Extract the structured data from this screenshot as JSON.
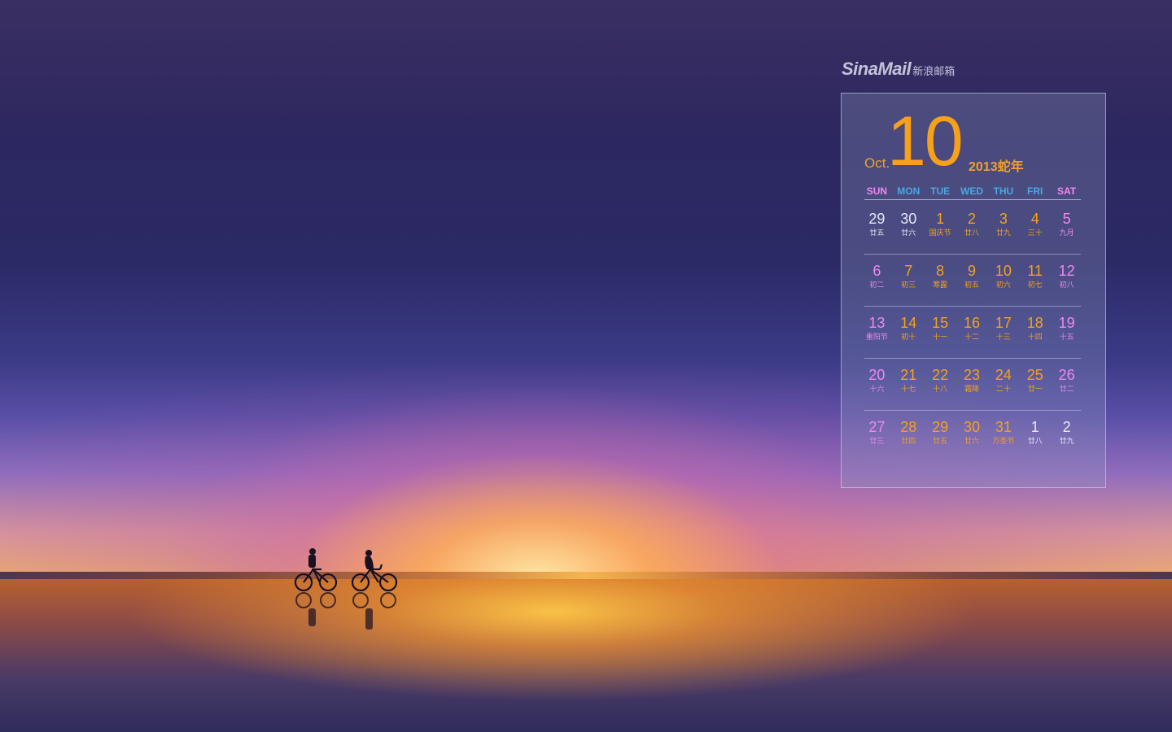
{
  "logo": {
    "brand": "SinaMail",
    "sub": "新浪邮箱"
  },
  "calendar": {
    "month_en": "Oct.",
    "month_num": "10",
    "year_label": "2013蛇年",
    "weekdays": [
      {
        "label": "SUN",
        "color": "#ef88ef"
      },
      {
        "label": "MON",
        "color": "#4aa8e0"
      },
      {
        "label": "TUE",
        "color": "#4aa8e0"
      },
      {
        "label": "WED",
        "color": "#4aa8e0"
      },
      {
        "label": "THU",
        "color": "#4aa8e0"
      },
      {
        "label": "FRI",
        "color": "#4aa8e0"
      },
      {
        "label": "SAT",
        "color": "#ef88ef"
      }
    ],
    "weeks": [
      [
        {
          "n": "29",
          "l": "廿五",
          "c": "white"
        },
        {
          "n": "30",
          "l": "廿六",
          "c": "white"
        },
        {
          "n": "1",
          "l": "国庆节",
          "c": "orange"
        },
        {
          "n": "2",
          "l": "廿八",
          "c": "orange"
        },
        {
          "n": "3",
          "l": "廿九",
          "c": "orange"
        },
        {
          "n": "4",
          "l": "三十",
          "c": "orange"
        },
        {
          "n": "5",
          "l": "九月",
          "c": "pink"
        }
      ],
      [
        {
          "n": "6",
          "l": "初二",
          "c": "pink"
        },
        {
          "n": "7",
          "l": "初三",
          "c": "orange"
        },
        {
          "n": "8",
          "l": "寒露",
          "c": "orange"
        },
        {
          "n": "9",
          "l": "初五",
          "c": "orange"
        },
        {
          "n": "10",
          "l": "初六",
          "c": "orange"
        },
        {
          "n": "11",
          "l": "初七",
          "c": "orange"
        },
        {
          "n": "12",
          "l": "初八",
          "c": "pink"
        }
      ],
      [
        {
          "n": "13",
          "l": "重阳节",
          "c": "pink"
        },
        {
          "n": "14",
          "l": "初十",
          "c": "orange"
        },
        {
          "n": "15",
          "l": "十一",
          "c": "orange"
        },
        {
          "n": "16",
          "l": "十二",
          "c": "orange"
        },
        {
          "n": "17",
          "l": "十三",
          "c": "orange"
        },
        {
          "n": "18",
          "l": "十四",
          "c": "orange"
        },
        {
          "n": "19",
          "l": "十五",
          "c": "pink"
        }
      ],
      [
        {
          "n": "20",
          "l": "十六",
          "c": "pink"
        },
        {
          "n": "21",
          "l": "十七",
          "c": "orange"
        },
        {
          "n": "22",
          "l": "十八",
          "c": "orange"
        },
        {
          "n": "23",
          "l": "霜降",
          "c": "orange"
        },
        {
          "n": "24",
          "l": "二十",
          "c": "orange"
        },
        {
          "n": "25",
          "l": "廿一",
          "c": "orange"
        },
        {
          "n": "26",
          "l": "廿二",
          "c": "pink"
        }
      ],
      [
        {
          "n": "27",
          "l": "廿三",
          "c": "pink"
        },
        {
          "n": "28",
          "l": "廿四",
          "c": "orange"
        },
        {
          "n": "29",
          "l": "廿五",
          "c": "orange"
        },
        {
          "n": "30",
          "l": "廿六",
          "c": "orange"
        },
        {
          "n": "31",
          "l": "万圣节",
          "c": "orange"
        },
        {
          "n": "1",
          "l": "廿八",
          "c": "white"
        },
        {
          "n": "2",
          "l": "廿九",
          "c": "white"
        }
      ]
    ]
  }
}
